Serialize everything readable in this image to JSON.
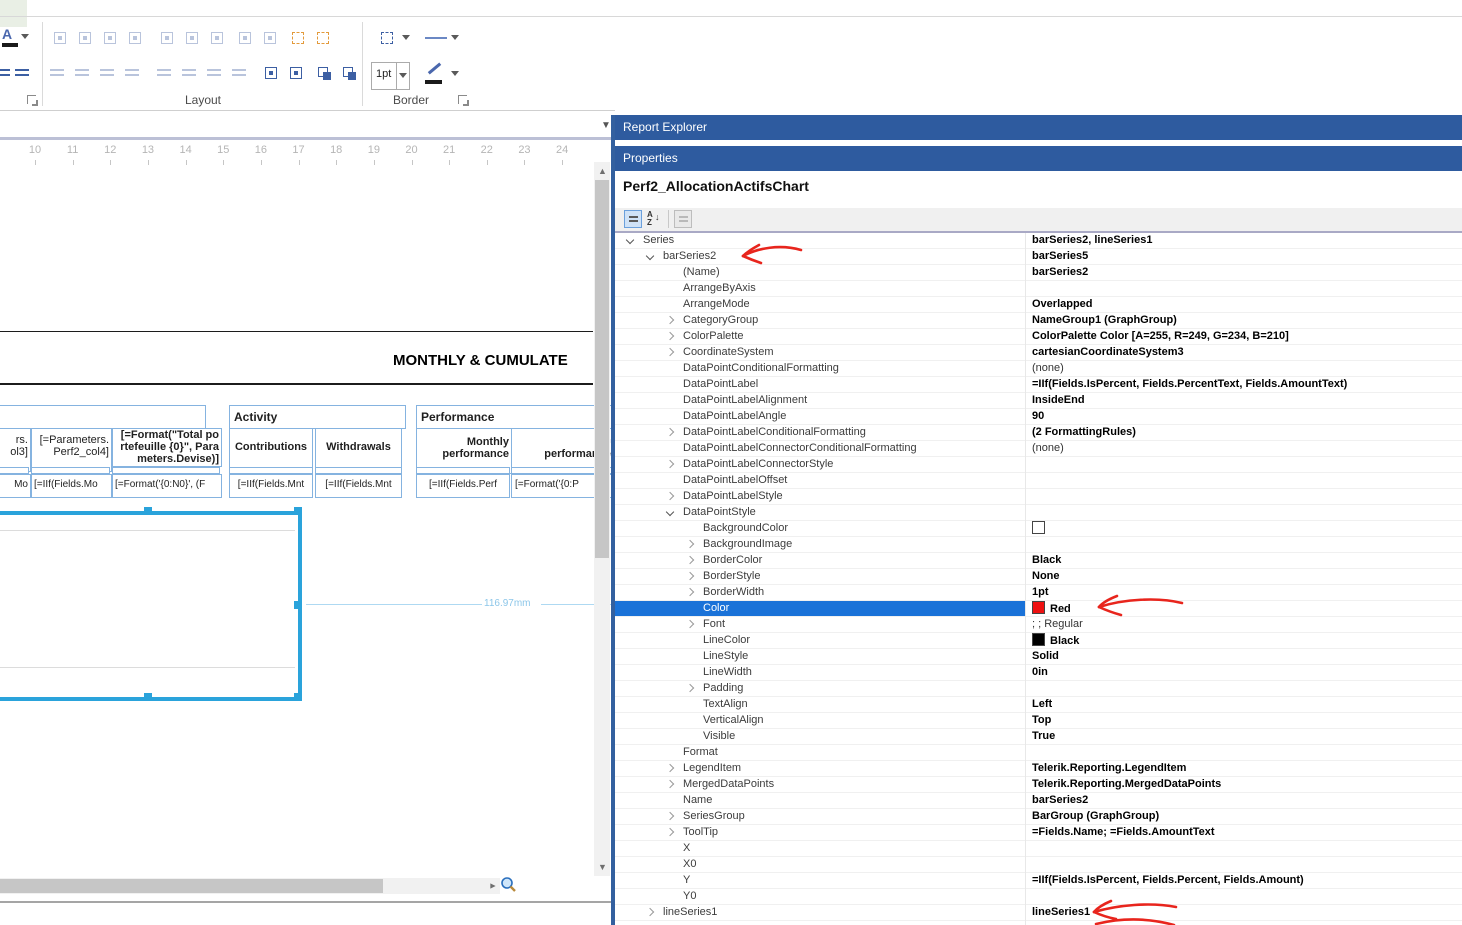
{
  "ribbon": {
    "layout_group_label": "Layout",
    "border_group_label": "Border",
    "border_width_value": "1pt",
    "font_color_letter": "A",
    "layout_icons_row1": [
      {
        "name": "align-lefts-icon",
        "glyph": "box",
        "color": "c-light"
      },
      {
        "name": "align-centers-icon",
        "glyph": "box",
        "color": "c-light"
      },
      {
        "name": "align-middles-icon",
        "glyph": "box",
        "color": "c-light"
      },
      {
        "name": "align-rights-icon",
        "glyph": "box",
        "color": "c-light"
      },
      {
        "name": "align-tops-icon",
        "glyph": "box",
        "color": "c-light"
      },
      {
        "name": "align-vcenters-icon",
        "glyph": "box",
        "color": "c-light"
      },
      {
        "name": "align-bottoms-icon",
        "glyph": "box",
        "color": "c-light"
      },
      {
        "name": "make-same-width-icon",
        "glyph": "box",
        "color": "c-light"
      },
      {
        "name": "make-same-height-icon",
        "glyph": "box",
        "color": "c-light"
      },
      {
        "name": "size-to-grid-icon",
        "glyph": "dashed",
        "color": "c-orange"
      },
      {
        "name": "snap-to-grid-icon",
        "glyph": "dashed",
        "color": "c-orange"
      }
    ],
    "layout_icons_row2": [
      {
        "name": "equal-horizontal-spacing-icon",
        "glyph": "bars",
        "color": "c-light"
      },
      {
        "name": "increase-horizontal-spacing-icon",
        "glyph": "bars",
        "color": "c-light"
      },
      {
        "name": "decrease-horizontal-spacing-icon",
        "glyph": "bars",
        "color": "c-light"
      },
      {
        "name": "remove-horizontal-spacing-icon",
        "glyph": "bars",
        "color": "c-light"
      },
      {
        "name": "equal-vertical-spacing-icon",
        "glyph": "bars",
        "color": "c-light"
      },
      {
        "name": "increase-vertical-spacing-icon",
        "glyph": "bars",
        "color": "c-light"
      },
      {
        "name": "decrease-vertical-spacing-icon",
        "glyph": "bars",
        "color": "c-light"
      },
      {
        "name": "remove-vertical-spacing-icon",
        "glyph": "bars",
        "color": "c-light"
      },
      {
        "name": "center-horizontally-icon",
        "glyph": "box",
        "color": "c-blue"
      },
      {
        "name": "center-vertically-icon",
        "glyph": "box",
        "color": "c-blue"
      },
      {
        "name": "bring-to-front-icon",
        "glyph": "layers",
        "color": "c-blue"
      },
      {
        "name": "send-to-back-icon",
        "glyph": "layers",
        "color": "c-blue"
      }
    ]
  },
  "design": {
    "ruler_numbers": [
      "10",
      "11",
      "12",
      "13",
      "14",
      "15",
      "16",
      "17",
      "18",
      "19",
      "20",
      "21",
      "22",
      "23",
      "24"
    ],
    "report_title": "MONTHLY & CUMULATE",
    "dimension_label": "116.97mm",
    "tables": {
      "left": {
        "header_cells": {
          "c1": "rs.\nol3]",
          "c2": "[=Parameters.\nPerf2_col4]",
          "c3": "[=Format(\"Total po\nrtefeuille {0}\", Para\nmeters.Devise)]"
        },
        "data_cells": {
          "c1": "Mo",
          "c2": "[=IIf(Fields.Mo",
          "c3": "[=Format('{0:N0}', (F"
        }
      },
      "activity": {
        "title": "Activity",
        "headers": {
          "c1": "Contributions",
          "c2": "Withdrawals"
        },
        "data": {
          "c1": "[=IIf(Fields.Mnt",
          "c2": "[=IIf(Fields.Mnt"
        }
      },
      "performance": {
        "title": "Performance",
        "headers": {
          "c1": "Monthly\nperformance",
          "c2": "Cu\nperformance i"
        },
        "data": {
          "c1": "[=IIf(Fields.Perf",
          "c2": "[=Format('{0:P"
        }
      }
    }
  },
  "panel": {
    "report_explorer_title": "Report Explorer",
    "properties_title": "Properties",
    "object_name": "Perf2_AllocationActifsChart",
    "toolbar_icons": [
      "categorized-icon",
      "alphabetical-sort-icon",
      "property-pages-icon"
    ],
    "rows": [
      {
        "n": "Series",
        "v": "barSeries2, lineSeries1",
        "i": 0,
        "e": "open"
      },
      {
        "n": "barSeries2",
        "v": "barSeries5",
        "i": 1,
        "e": "open"
      },
      {
        "n": "(Name)",
        "v": "barSeries2",
        "i": 2
      },
      {
        "n": "ArrangeByAxis",
        "v": "",
        "i": 2
      },
      {
        "n": "ArrangeMode",
        "v": "Overlapped",
        "i": 2
      },
      {
        "n": "CategoryGroup",
        "v": "NameGroup1 (GraphGroup)",
        "i": 2,
        "e": "closed"
      },
      {
        "n": "ColorPalette",
        "v": "ColorPalette Color [A=255, R=249, G=234, B=210]",
        "i": 2,
        "e": "closed"
      },
      {
        "n": "CoordinateSystem",
        "v": "cartesianCoordinateSystem3",
        "i": 2,
        "e": "closed"
      },
      {
        "n": "DataPointConditionalFormatting",
        "v": "(none)",
        "i": 2,
        "plain": true
      },
      {
        "n": "DataPointLabel",
        "v": "=IIf(Fields.IsPercent, Fields.PercentText, Fields.AmountText)",
        "i": 2
      },
      {
        "n": "DataPointLabelAlignment",
        "v": "InsideEnd",
        "i": 2
      },
      {
        "n": "DataPointLabelAngle",
        "v": "90",
        "i": 2
      },
      {
        "n": "DataPointLabelConditionalFormatting",
        "v": "(2 FormattingRules)",
        "i": 2,
        "e": "closed"
      },
      {
        "n": "DataPointLabelConnectorConditionalFormatting",
        "v": "(none)",
        "i": 2,
        "plain": true
      },
      {
        "n": "DataPointLabelConnectorStyle",
        "v": "",
        "i": 2,
        "e": "closed"
      },
      {
        "n": "DataPointLabelOffset",
        "v": "",
        "i": 2
      },
      {
        "n": "DataPointLabelStyle",
        "v": "",
        "i": 2,
        "e": "closed"
      },
      {
        "n": "DataPointStyle",
        "v": "",
        "i": 2,
        "e": "open"
      },
      {
        "n": "BackgroundColor",
        "v": "",
        "i": 3,
        "swatch": "#ffffff"
      },
      {
        "n": "BackgroundImage",
        "v": "",
        "i": 3,
        "e": "closed"
      },
      {
        "n": "BorderColor",
        "v": "Black",
        "i": 3,
        "e": "closed"
      },
      {
        "n": "BorderStyle",
        "v": "None",
        "i": 3,
        "e": "closed"
      },
      {
        "n": "BorderWidth",
        "v": "1pt",
        "i": 3,
        "e": "closed"
      },
      {
        "n": "Color",
        "v": "Red",
        "i": 3,
        "selected": true,
        "swatch": "#ee1111"
      },
      {
        "n": "Font",
        "v": "; ; Regular",
        "i": 3,
        "e": "closed",
        "plain": true
      },
      {
        "n": "LineColor",
        "v": "Black",
        "i": 3,
        "swatch": "#000000"
      },
      {
        "n": "LineStyle",
        "v": "Solid",
        "i": 3
      },
      {
        "n": "LineWidth",
        "v": "0in",
        "i": 3
      },
      {
        "n": "Padding",
        "v": "",
        "i": 3,
        "e": "closed"
      },
      {
        "n": "TextAlign",
        "v": "Left",
        "i": 3
      },
      {
        "n": "VerticalAlign",
        "v": "Top",
        "i": 3
      },
      {
        "n": "Visible",
        "v": "True",
        "i": 3
      },
      {
        "n": "Format",
        "v": "",
        "i": 2
      },
      {
        "n": "LegendItem",
        "v": "Telerik.Reporting.LegendItem",
        "i": 2,
        "e": "closed"
      },
      {
        "n": "MergedDataPoints",
        "v": "Telerik.Reporting.MergedDataPoints",
        "i": 2,
        "e": "closed"
      },
      {
        "n": "Name",
        "v": "barSeries2",
        "i": 2
      },
      {
        "n": "SeriesGroup",
        "v": "BarGroup (GraphGroup)",
        "i": 2,
        "e": "closed"
      },
      {
        "n": "ToolTip",
        "v": "=Fields.Name; =Fields.AmountText",
        "i": 2,
        "e": "closed"
      },
      {
        "n": "X",
        "v": "",
        "i": 2
      },
      {
        "n": "X0",
        "v": "",
        "i": 2
      },
      {
        "n": "Y",
        "v": "=IIf(Fields.IsPercent, Fields.Percent, Fields.Amount)",
        "i": 2
      },
      {
        "n": "Y0",
        "v": "",
        "i": 2
      },
      {
        "n": "lineSeries1",
        "v": "lineSeries1",
        "i": 1,
        "e": "closed"
      }
    ]
  },
  "annotations": {
    "arrow_color": "#e8251d"
  },
  "colors": {
    "panel_header_blue": "#2e5b9f",
    "selected_row_blue": "#1a72d8",
    "selection_cyan": "#2aa3db",
    "table_border_blue": "#85b3e0",
    "swatch_red": "#ee1111"
  }
}
